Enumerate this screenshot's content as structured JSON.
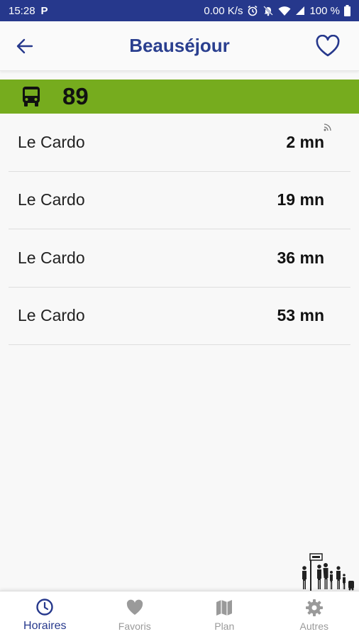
{
  "status_bar": {
    "time": "15:28",
    "app_indicator": "P",
    "net_speed": "0.00 K/s",
    "battery": "100 %"
  },
  "header": {
    "title": "Beauséjour"
  },
  "line": {
    "number": "89",
    "color": "#76ac1e"
  },
  "departures": [
    {
      "destination": "Le Cardo",
      "wait": "2 mn",
      "realtime": true
    },
    {
      "destination": "Le Cardo",
      "wait": "19 mn",
      "realtime": false
    },
    {
      "destination": "Le Cardo",
      "wait": "36 mn",
      "realtime": false
    },
    {
      "destination": "Le Cardo",
      "wait": "53 mn",
      "realtime": false
    }
  ],
  "nav": {
    "horaires": "Horaires",
    "favoris": "Favoris",
    "plan": "Plan",
    "autres": "Autres"
  },
  "colors": {
    "primary": "#26388c",
    "title": "#2a3f8f",
    "inactive": "#9a9a9a"
  }
}
